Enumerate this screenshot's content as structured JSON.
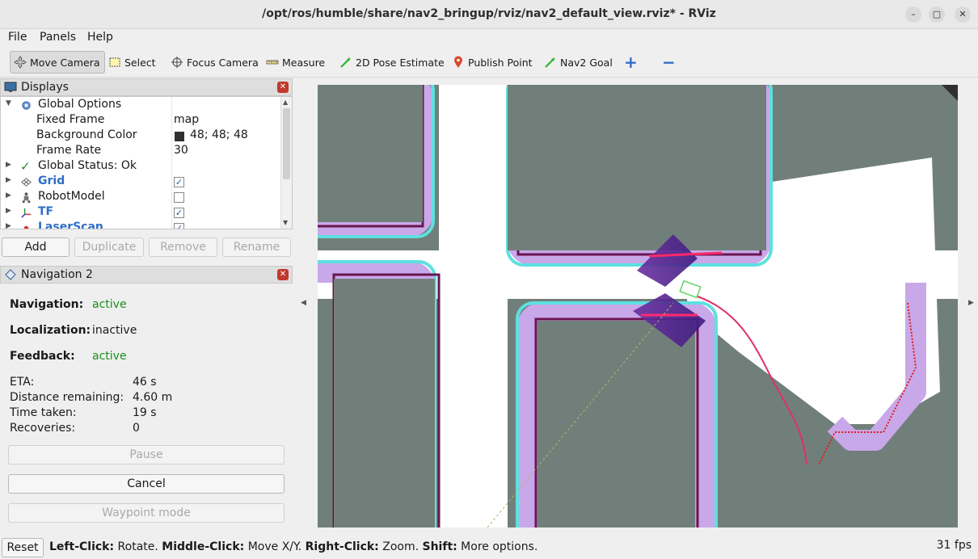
{
  "window": {
    "title": "/opt/ros/humble/share/nav2_bringup/rviz/nav2_default_view.rviz* - RViz",
    "minimize_glyph": "–",
    "maximize_glyph": "▢",
    "close_glyph": "✕"
  },
  "menu": [
    {
      "label": "File",
      "accel": "F"
    },
    {
      "label": "Panels",
      "accel": "P"
    },
    {
      "label": "Help",
      "accel": "H"
    }
  ],
  "toolbar": {
    "move_camera": "Move Camera",
    "select": "Select",
    "focus_camera": "Focus Camera",
    "measure": "Measure",
    "pose_estimate": "2D Pose Estimate",
    "publish_point": "Publish Point",
    "nav2_goal": "Nav2 Goal",
    "add_glyph": "+",
    "remove_glyph": "−"
  },
  "displays": {
    "title": "Displays",
    "rows": [
      {
        "label": "Global Options",
        "value": ""
      },
      {
        "label": "Fixed Frame",
        "value": "map"
      },
      {
        "label": "Background Color",
        "value": "48; 48; 48"
      },
      {
        "label": "Frame Rate",
        "value": "30"
      },
      {
        "label": "Global Status: Ok",
        "value": ""
      },
      {
        "label": "Grid",
        "checked": true
      },
      {
        "label": "RobotModel",
        "checked": false
      },
      {
        "label": "TF",
        "checked": true
      },
      {
        "label": "LaserScan",
        "checked": true
      }
    ],
    "buttons": {
      "add": "Add",
      "duplicate": "Duplicate",
      "remove": "Remove",
      "rename": "Rename"
    }
  },
  "navigation": {
    "title": "Navigation 2",
    "navigation_label": "Navigation:",
    "navigation_value": "active",
    "localization_label": "Localization:",
    "localization_value": "inactive",
    "feedback_label": "Feedback:",
    "feedback_value": "active",
    "eta_label": "ETA:",
    "eta_value": "46 s",
    "distance_label": "Distance remaining:",
    "distance_value": "4.60 m",
    "time_label": "Time taken:",
    "time_value": "19 s",
    "recoveries_label": "Recoveries:",
    "recoveries_value": "0",
    "pause": "Pause",
    "cancel": "Cancel",
    "waypoint": "Waypoint mode"
  },
  "statusbar": {
    "reset": "Reset",
    "hint_1_key": "Left-Click:",
    "hint_1_val": " Rotate. ",
    "hint_2_key": "Middle-Click:",
    "hint_2_val": " Move X/Y. ",
    "hint_3_key": "Right-Click:",
    "hint_3_val": " Zoom. ",
    "hint_4_key": "Shift:",
    "hint_4_val": " More options.",
    "fps": "31 fps"
  },
  "colors": {
    "background": "#303030",
    "map_occupied": "#717f7a",
    "map_free": "#ffffff",
    "costmap_inflation": "#c8a8e8",
    "costmap_edge": "#5ee0e0",
    "lethal": "#6a1550",
    "active_green": "#1a8f1a",
    "bold_blue": "#2f6ec7"
  }
}
